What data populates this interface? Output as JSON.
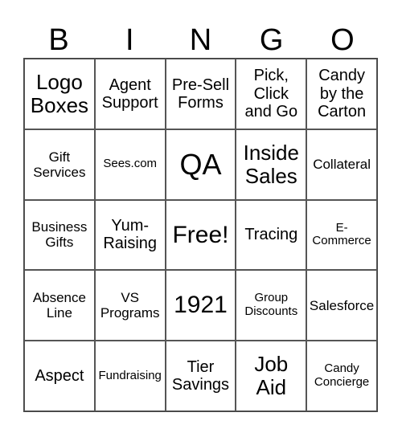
{
  "header": [
    "B",
    "I",
    "N",
    "G",
    "O"
  ],
  "cells": [
    "Logo Boxes",
    "Agent Support",
    "Pre-Sell Forms",
    "Pick, Click and Go",
    "Candy by the Carton",
    "Gift Services",
    "Sees.com",
    "QA",
    "Inside Sales",
    "Collateral",
    "Business Gifts",
    "Yum-Raising",
    "Free!",
    "Tracing",
    "E-Commerce",
    "Absence Line",
    "VS Programs",
    "1921",
    "Group Discounts",
    "Salesforce",
    "Aspect",
    "Fundraising",
    "Tier Savings",
    "Job Aid",
    "Candy Concierge"
  ]
}
